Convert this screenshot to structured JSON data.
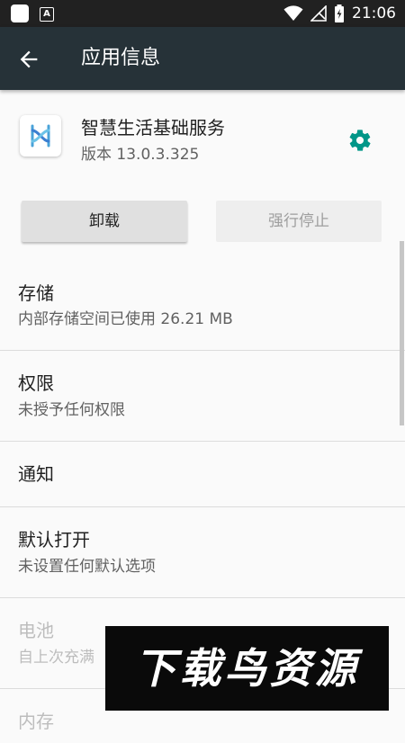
{
  "status_bar": {
    "time": "21:06",
    "notification_badge": "A"
  },
  "app_bar": {
    "title": "应用信息"
  },
  "app": {
    "name": "智慧生活基础服务",
    "version": "版本 13.0.3.325"
  },
  "buttons": {
    "uninstall": "卸载",
    "force_stop": "强行停止"
  },
  "prefs": [
    {
      "title": "存储",
      "summary": "内部存储空间已使用 26.21 MB"
    },
    {
      "title": "权限",
      "summary": "未授予任何权限"
    },
    {
      "title": "通知",
      "summary": ""
    },
    {
      "title": "默认打开",
      "summary": "未设置任何默认选项"
    },
    {
      "title": "电池",
      "summary": "自上次充满"
    },
    {
      "title": "内存",
      "summary": ""
    }
  ],
  "watermark": "下载鸟资源",
  "colors": {
    "app_bar": "#263238",
    "status_bar": "#212121",
    "accent": "#009688"
  }
}
